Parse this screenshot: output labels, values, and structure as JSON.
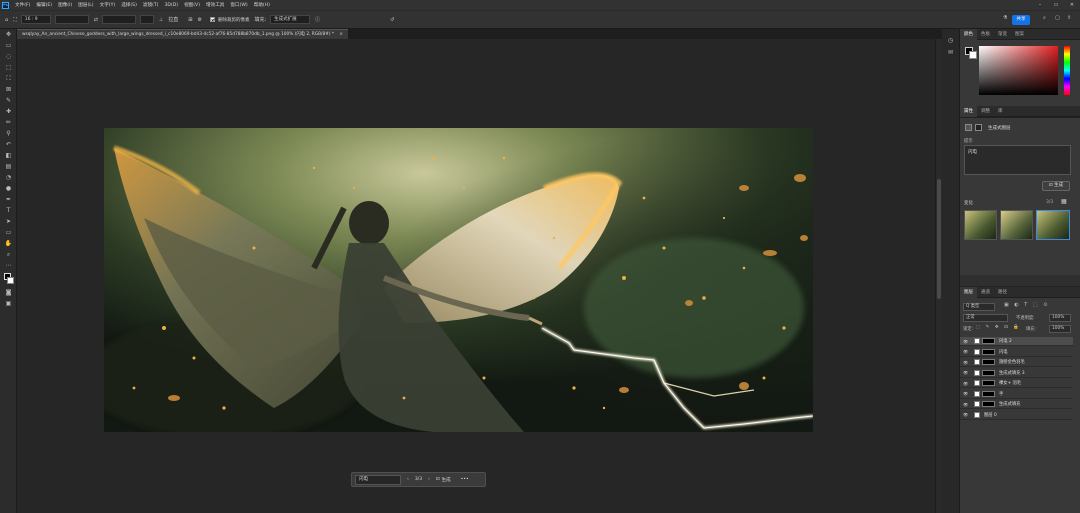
{
  "menu": [
    "文件(F)",
    "编辑(E)",
    "图像(I)",
    "图层(L)",
    "文字(Y)",
    "选择(S)",
    "滤镜(T)",
    "3D(D)",
    "视图(V)",
    "增效工具",
    "窗口(W)",
    "帮助(H)"
  ],
  "options": {
    "ratio": "16 : 9",
    "straighten": "拉直",
    "delete_pixels": "删除裁剪的像素",
    "fill_label": "填充:",
    "fill_value": "生成式扩展",
    "share": "共享"
  },
  "document_tab": "wsqlyay_An_ancient_Chinese_goddess_with_large_wings_dressed_i_c10e8069-bd43-4c52-af76-85d788b870db_1.png @ 100% (闪电 2, RGB/8#) *",
  "context_bar": {
    "prompt": "闪电",
    "counter": "3/3",
    "generate": "生成",
    "more": "•••"
  },
  "color_panel": {
    "tabs": [
      "颜色",
      "色板",
      "渐变",
      "图案"
    ]
  },
  "properties_panel": {
    "tabs": [
      "属性",
      "调整",
      "库"
    ],
    "layer_type": "生成式图层",
    "prompt_label": "提示",
    "prompt_value": "闪电",
    "generate": "生成",
    "variations_label": "变化",
    "variations_counter": "3/3"
  },
  "layers_panel": {
    "tabs": [
      "图层",
      "通道",
      "路径"
    ],
    "kind": "Q 类型",
    "blend": "正常",
    "opacity_label": "不透明度:",
    "opacity": "100%",
    "lock_label": "锁定:",
    "fill_label": "填充:",
    "fill": "100%",
    "layers": [
      {
        "name": "闪电 2",
        "selected": true
      },
      {
        "name": "闪电",
        "selected": false
      },
      {
        "name": "翅膀金色羽毛",
        "selected": false
      },
      {
        "name": "生成式填充 3",
        "selected": false
      },
      {
        "name": "裸女+ 羽毛",
        "selected": false
      },
      {
        "name": "手",
        "selected": false
      },
      {
        "name": "生成式填充",
        "selected": false
      },
      {
        "name": "图层 0",
        "selected": false
      }
    ]
  }
}
